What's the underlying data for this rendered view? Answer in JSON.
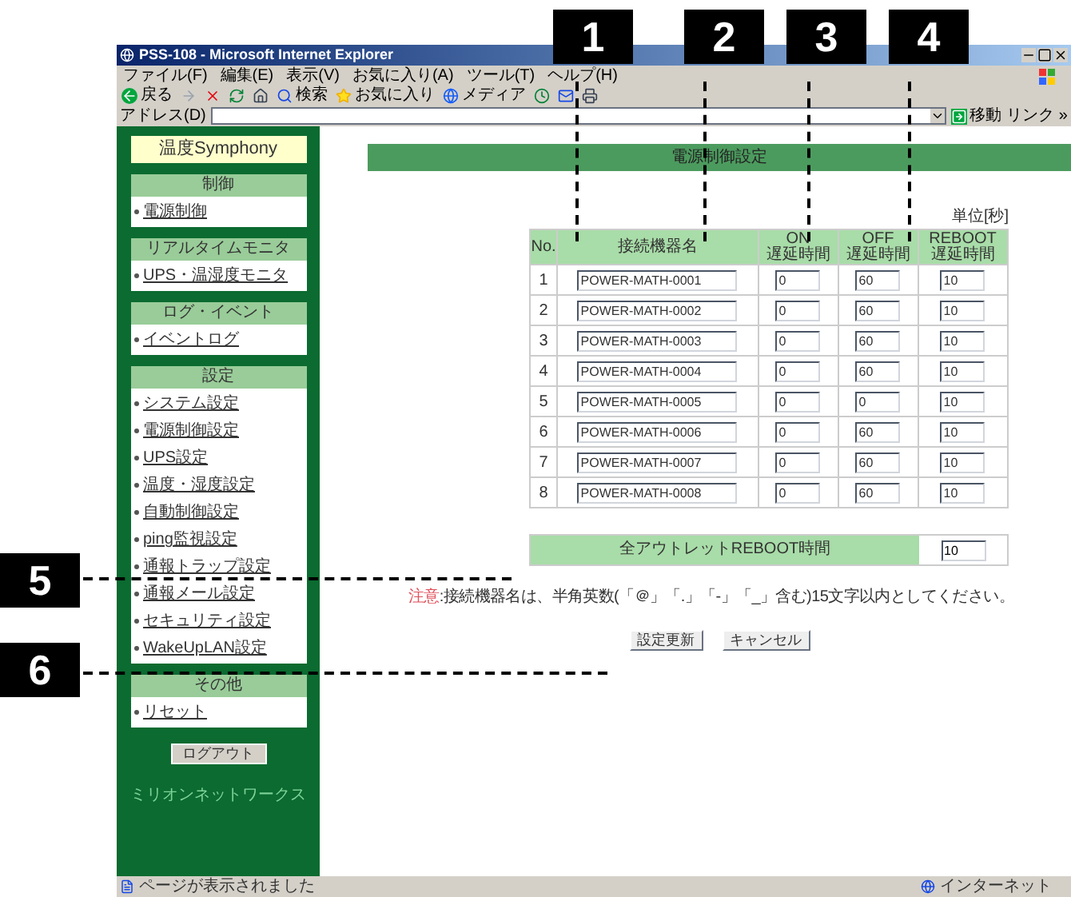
{
  "callouts": [
    "1",
    "2",
    "3",
    "4",
    "5",
    "6"
  ],
  "browser": {
    "title": "PSS-108 - Microsoft Internet Explorer",
    "menu": [
      "ファイル(F)",
      "編集(E)",
      "表示(V)",
      "お気に入り(A)",
      "ツール(T)",
      "ヘルプ(H)"
    ],
    "toolbar": [
      "戻る",
      "検索",
      "お気に入り",
      "メディア"
    ],
    "address_label": "アドレス(D)",
    "go": "移動",
    "links": "リンク »"
  },
  "sidebar": {
    "logo": "温度Symphony",
    "sections": [
      {
        "heading": "制御",
        "items": [
          "電源制御"
        ]
      },
      {
        "heading": "リアルタイムモニタ",
        "items": [
          "UPS・温湿度モニタ"
        ]
      },
      {
        "heading": "ログ・イベント",
        "items": [
          "イベントログ"
        ]
      },
      {
        "heading": "設定",
        "items": [
          "システム設定",
          "電源制御設定",
          "UPS設定",
          "温度・湿度設定",
          "自動制御設定",
          "ping監視設定",
          "通報トラップ設定",
          "通報メール設定",
          "セキュリティ設定",
          "WakeUpLAN設定"
        ]
      },
      {
        "heading": "その他",
        "items": [
          "リセット"
        ]
      }
    ],
    "logout": "ログアウト",
    "footer": "ミリオンネットワークス"
  },
  "main": {
    "title": "電源制御設定",
    "unit": "単位[秒]",
    "columns": [
      "No.",
      "接続機器名",
      "ON\n遅延時間",
      "OFF\n遅延時間",
      "REBOOT\n遅延時間"
    ],
    "rows": [
      {
        "no": "1",
        "name": "POWER-MATH-0001",
        "on": "0",
        "off": "60",
        "reboot": "10"
      },
      {
        "no": "2",
        "name": "POWER-MATH-0002",
        "on": "0",
        "off": "60",
        "reboot": "10"
      },
      {
        "no": "3",
        "name": "POWER-MATH-0003",
        "on": "0",
        "off": "60",
        "reboot": "10"
      },
      {
        "no": "4",
        "name": "POWER-MATH-0004",
        "on": "0",
        "off": "60",
        "reboot": "10"
      },
      {
        "no": "5",
        "name": "POWER-MATH-0005",
        "on": "0",
        "off": "0",
        "reboot": "10"
      },
      {
        "no": "6",
        "name": "POWER-MATH-0006",
        "on": "0",
        "off": "60",
        "reboot": "10"
      },
      {
        "no": "7",
        "name": "POWER-MATH-0007",
        "on": "0",
        "off": "60",
        "reboot": "10"
      },
      {
        "no": "8",
        "name": "POWER-MATH-0008",
        "on": "0",
        "off": "60",
        "reboot": "10"
      }
    ],
    "all_reboot": {
      "label": "全アウトレットREBOOT時間",
      "value": "10"
    },
    "note": {
      "label": "注意",
      "text": ":接続機器名は、半角英数(「＠」「.」「-」「_」含む)15文字以内としてください。"
    },
    "buttons": [
      "設定更新",
      "キャンセル"
    ]
  },
  "status_bar": {
    "left": "ページが表示されました",
    "right": "インターネット"
  }
}
